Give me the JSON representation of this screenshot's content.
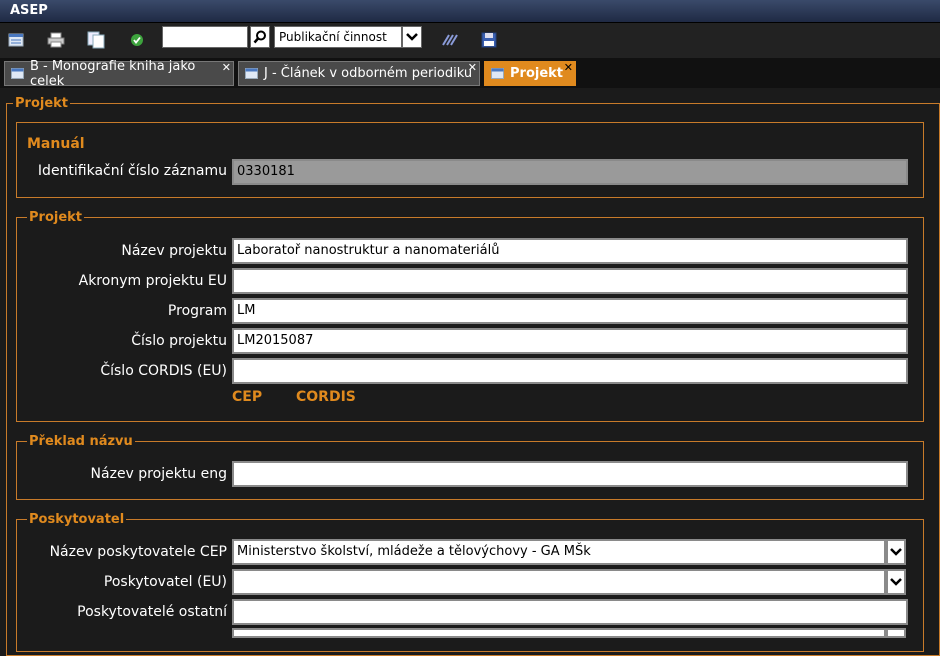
{
  "app": {
    "title": "ASEP"
  },
  "toolbar": {
    "search_value": "",
    "select_value": "Publikační činnost",
    "icons": [
      "list-icon",
      "print-icon",
      "copy-icon",
      "check-icon",
      "search-icon",
      "chevron-down-icon",
      "tools-icon",
      "save-icon"
    ]
  },
  "tabs": [
    {
      "label": "B - Monografie kniha jako celek",
      "active": false
    },
    {
      "label": "J - Článek v odborném periodiku",
      "active": false
    },
    {
      "label": "Projekt",
      "active": true
    }
  ],
  "main": {
    "outer_legend": "Projekt",
    "manual": {
      "heading": "Manuál",
      "id_label": "Identifikační číslo záznamu",
      "id_value": "0330181"
    },
    "project": {
      "legend": "Projekt",
      "name_label": "Název projektu",
      "name_value": "Laboratoř nanostruktur a nanomateriálů",
      "acronym_label": "Akronym projektu EU",
      "acronym_value": "",
      "program_label": "Program",
      "program_value": "LM",
      "number_label": "Číslo projektu",
      "number_value": "LM2015087",
      "cordis_label": "Číslo CORDIS (EU)",
      "cordis_value": "",
      "link_cep": "CEP",
      "link_cordis": "CORDIS"
    },
    "translation": {
      "legend": "Překlad názvu",
      "name_eng_label": "Název projektu eng",
      "name_eng_value": ""
    },
    "provider": {
      "legend": "Poskytovatel",
      "cep_label": "Název poskytovatele CEP",
      "cep_value": "Ministerstvo školství, mládeže a tělovýchovy - GA MŠk",
      "eu_label": "Poskytovatel (EU)",
      "eu_value": "",
      "other_label": "Poskytovatelé ostatní",
      "other_value": ""
    }
  },
  "colors": {
    "accent": "#e08a1e",
    "background": "#1b1b1b"
  }
}
